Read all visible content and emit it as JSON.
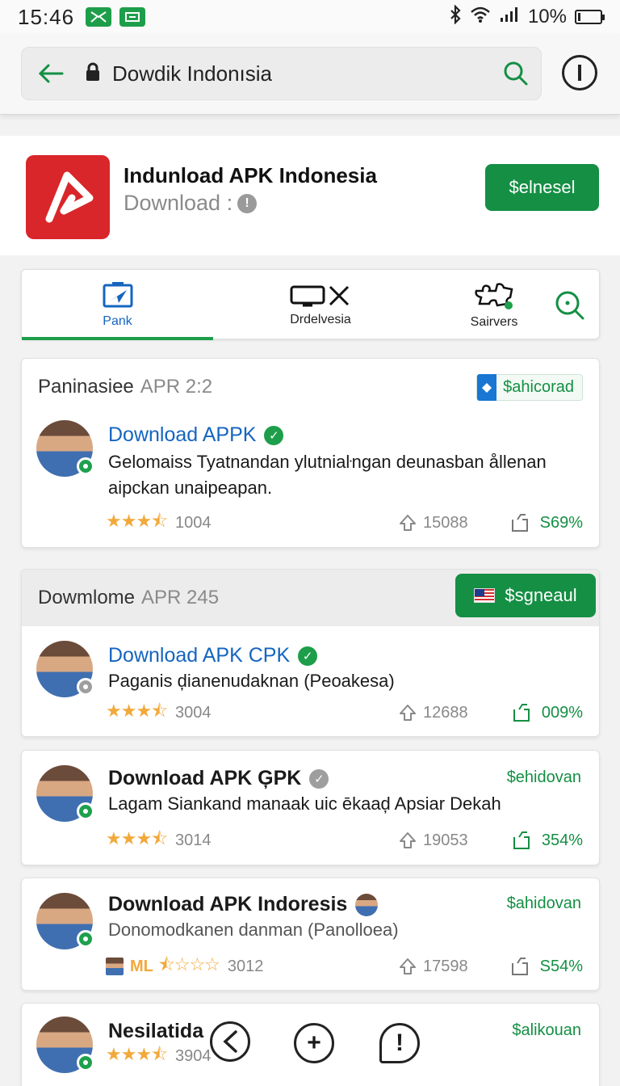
{
  "status_bar": {
    "time": "15:46",
    "battery": "10%",
    "battery_level": 0.1
  },
  "search": {
    "query": "Dowdik Indonısia"
  },
  "app": {
    "title": "Indunload APK Indonesia",
    "subtitle": "Download :",
    "primary_button": "$elnesel",
    "brand_color": "#d9262b",
    "accent_color": "#148f44"
  },
  "tabs": [
    {
      "label": "Pank",
      "icon": "send-icon",
      "active": true
    },
    {
      "label": "Drdelvesia",
      "icon": "tv-close-icon",
      "active": false
    },
    {
      "label": "Sairvers",
      "icon": "puzzle-icon",
      "active": false
    },
    {
      "label": "",
      "icon": "search-icon",
      "active": false
    }
  ],
  "sections": [
    {
      "name": "Paninasiee",
      "date": "APR 2:2",
      "chip": "$ahicorad",
      "entries": [
        {
          "title": "Download APPK",
          "desc": "Gelomaiss Tyatnandan ylutniaŀngan deunasban ållenan aipckan unaipeapan.",
          "rating": "1004",
          "stars": 3.5,
          "upvotes": "15088",
          "share": "S69%"
        }
      ]
    },
    {
      "name": "Dowmlome",
      "date": "APR 245",
      "button": "$sgneaul",
      "entries": [
        {
          "title": "Download APK CPK",
          "desc": "Paganis ḑianenudaknan (Peoakesa)",
          "rating": "3004",
          "stars": 3.5,
          "upvotes": "12688",
          "share": "009%"
        }
      ]
    }
  ],
  "items": [
    {
      "title": "Download APK ĢPK",
      "desc": "Lagam Siankand manaak uic ēkaaḑ  Apsiar Dekah",
      "action": "$ehidovan",
      "rating": "3014",
      "stars": 3.5,
      "upvotes": "19053",
      "share": "354%"
    },
    {
      "title": "Download APK Indoresis",
      "desc": "Donomodkanen danman (Panolloea)",
      "action": "$ahidovan",
      "badge_text": "ML",
      "rating": "3012",
      "stars": 0.5,
      "upvotes": "17598",
      "share": "S54%"
    },
    {
      "title": "Nesilatida",
      "action": "$alikouan",
      "rating": "3904",
      "stars": 3.5
    }
  ],
  "bottom_nav": [
    {
      "icon": "back-icon"
    },
    {
      "icon": "add-icon",
      "label": "+"
    },
    {
      "icon": "chat-alert-icon",
      "label": "!"
    }
  ]
}
